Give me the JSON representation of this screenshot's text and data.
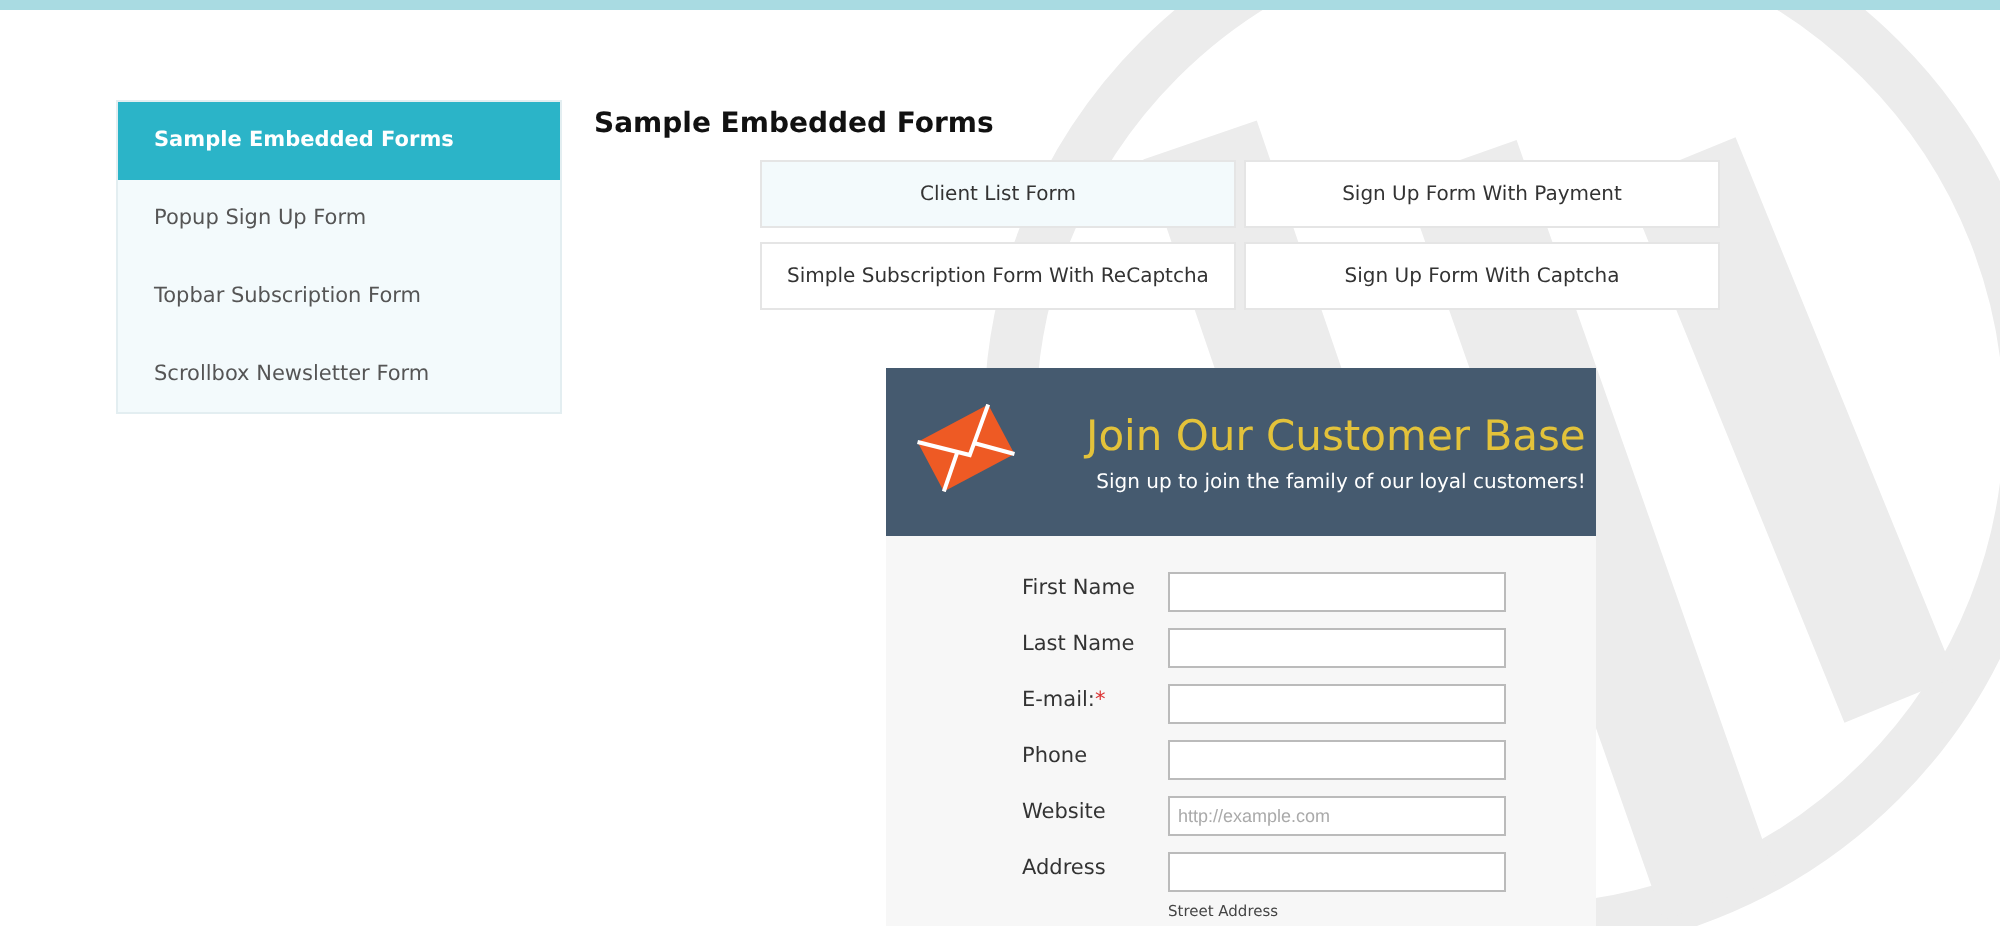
{
  "sidebar": {
    "items": [
      {
        "label": "Sample Embedded Forms",
        "selected": true
      },
      {
        "label": "Popup Sign Up Form",
        "selected": false
      },
      {
        "label": "Topbar Subscription Form",
        "selected": false
      },
      {
        "label": "Scrollbox Newsletter Form",
        "selected": false
      }
    ]
  },
  "heading": "Sample Embedded Forms",
  "form_tabs": [
    {
      "label": "Client List Form",
      "selected": true
    },
    {
      "label": "Sign Up Form With Payment",
      "selected": false
    },
    {
      "label": "Simple Subscription Form With ReCaptcha",
      "selected": false
    },
    {
      "label": "Sign Up Form With Captcha",
      "selected": false
    }
  ],
  "form": {
    "title": "Join Our Customer Base",
    "subtitle": "Sign up to join the family of our loyal customers!",
    "fields": [
      {
        "label": "First Name"
      },
      {
        "label": "Last Name"
      },
      {
        "label": "E-mail:",
        "required_mark": "*"
      },
      {
        "label": "Phone"
      },
      {
        "label": "Website",
        "placeholder": "http://example.com"
      },
      {
        "label": "Address",
        "hint": "Street Address"
      }
    ]
  }
}
